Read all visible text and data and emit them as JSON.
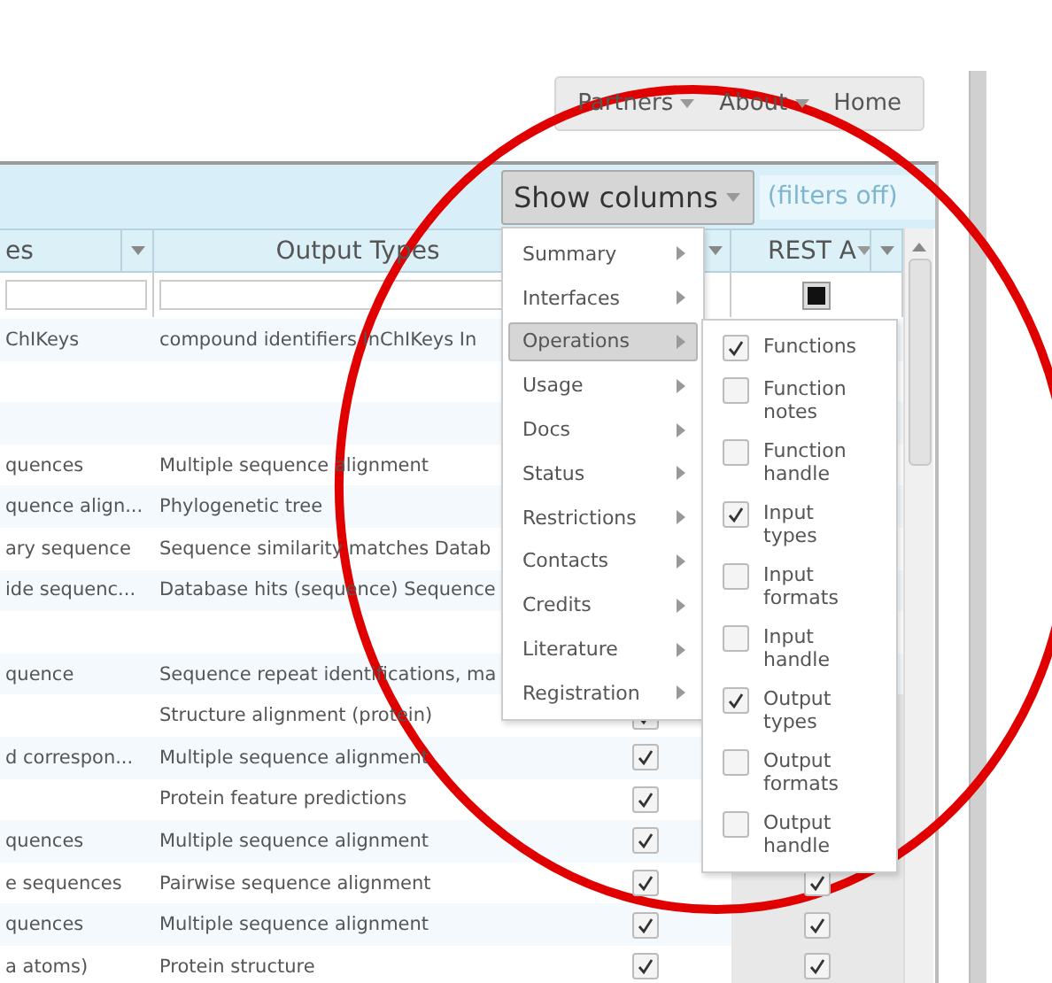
{
  "nav": [
    {
      "label": "Partners",
      "dropdown": true
    },
    {
      "label": "About",
      "dropdown": true
    },
    {
      "label": "Home",
      "dropdown": false
    }
  ],
  "toolbar": {
    "show_columns": "Show columns",
    "filters": "(filters off)"
  },
  "table": {
    "columns": [
      {
        "label": "es",
        "kind": "text"
      },
      {
        "label": "Output Types",
        "kind": "text"
      },
      {
        "kind": "check"
      },
      {
        "label": "REST A",
        "kind": "check",
        "filter_checked": true,
        "caret": true
      }
    ],
    "rows": [
      {
        "column_1": "ChIKeys",
        "column_2": "compound identifiers InChIKeys In"
      },
      {},
      {},
      {
        "column_1": "quences",
        "column_2": "Multiple sequence alignment"
      },
      {
        "column_1": "quence align...",
        "column_2": "Phylogenetic tree"
      },
      {
        "column_1": "ary sequence",
        "column_2": "Sequence similarity matches Datab"
      },
      {
        "column_1": "ide sequenc...",
        "column_2": "Database hits (sequence) Sequence"
      },
      {},
      {
        "column_1": "quence",
        "column_2": "Sequence repeat identifications, ma"
      },
      {
        "column_2": "Structure alignment (protein)",
        "check_3": true
      },
      {
        "column_1": "d correspon...",
        "column_2": "Multiple sequence alignment",
        "check_3": true
      },
      {
        "column_2": "Protein feature predictions",
        "check_3": true
      },
      {
        "column_1": "quences",
        "column_2": "Multiple sequence alignment",
        "check_3": true
      },
      {
        "column_1": "e sequences",
        "column_2": "Pairwise sequence alignment",
        "check_3": true,
        "check_4": true
      },
      {
        "column_1": "quences",
        "column_2": "Multiple sequence alignment",
        "check_3": true,
        "check_4": true
      },
      {
        "column_1": "a atoms)",
        "column_2": "Protein structure",
        "check_3": true,
        "check_4": true
      }
    ]
  },
  "menu": {
    "items": [
      {
        "label": "Summary",
        "selected": false
      },
      {
        "label": "Interfaces",
        "selected": false
      },
      {
        "label": "Operations",
        "selected": true
      },
      {
        "label": "Usage",
        "selected": false
      },
      {
        "label": "Docs",
        "selected": false
      },
      {
        "label": "Status",
        "selected": false
      },
      {
        "label": "Restrictions",
        "selected": false
      },
      {
        "label": "Contacts",
        "selected": false
      },
      {
        "label": "Credits",
        "selected": false
      },
      {
        "label": "Literature",
        "selected": false
      },
      {
        "label": "Registration",
        "selected": false
      }
    ],
    "submenu": [
      {
        "label": "Functions",
        "checked": true
      },
      {
        "label": "Function notes",
        "checked": false
      },
      {
        "label": "Function handle",
        "checked": false
      },
      {
        "label": "Input types",
        "checked": true
      },
      {
        "label": "Input formats",
        "checked": false
      },
      {
        "label": "Input handle",
        "checked": false
      },
      {
        "label": "Output types",
        "checked": true
      },
      {
        "label": "Output formats",
        "checked": false
      },
      {
        "label": "Output handle",
        "checked": false
      }
    ]
  }
}
